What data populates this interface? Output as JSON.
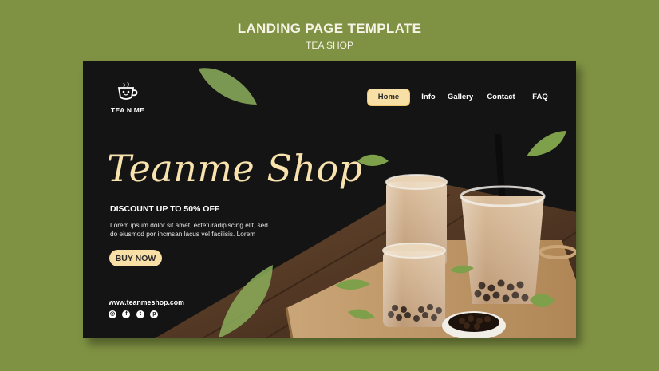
{
  "header": {
    "title": "LANDING PAGE TEMPLATE",
    "subtitle": "TEA SHOP"
  },
  "logo": {
    "text": "TEA N ME",
    "icon": "tea-cup-face-icon"
  },
  "nav": {
    "items": [
      {
        "label": "Home",
        "active": true
      },
      {
        "label": "Info"
      },
      {
        "label": "Gallery"
      },
      {
        "label": "Contact"
      },
      {
        "label": "FAQ"
      }
    ]
  },
  "hero": {
    "title": "Teanme Shop",
    "discount": "DISCOUNT UP TO 50% OFF",
    "description_line1": "Lorem ipsum dolor sit amet, ecteturadipiscing elit, sed",
    "description_line2": "do eiusmod por incmsan lacus vel facilisis. Lorem",
    "cta": "BUY NOW"
  },
  "footer": {
    "website": "www.teanmeshop.com",
    "socials": [
      "instagram-icon",
      "facebook-icon",
      "twitter-icon",
      "pinterest-icon"
    ]
  },
  "colors": {
    "background": "#7f9243",
    "canvas": "#141414",
    "accent": "#f7dfa5",
    "title": "#f8e2ad"
  }
}
